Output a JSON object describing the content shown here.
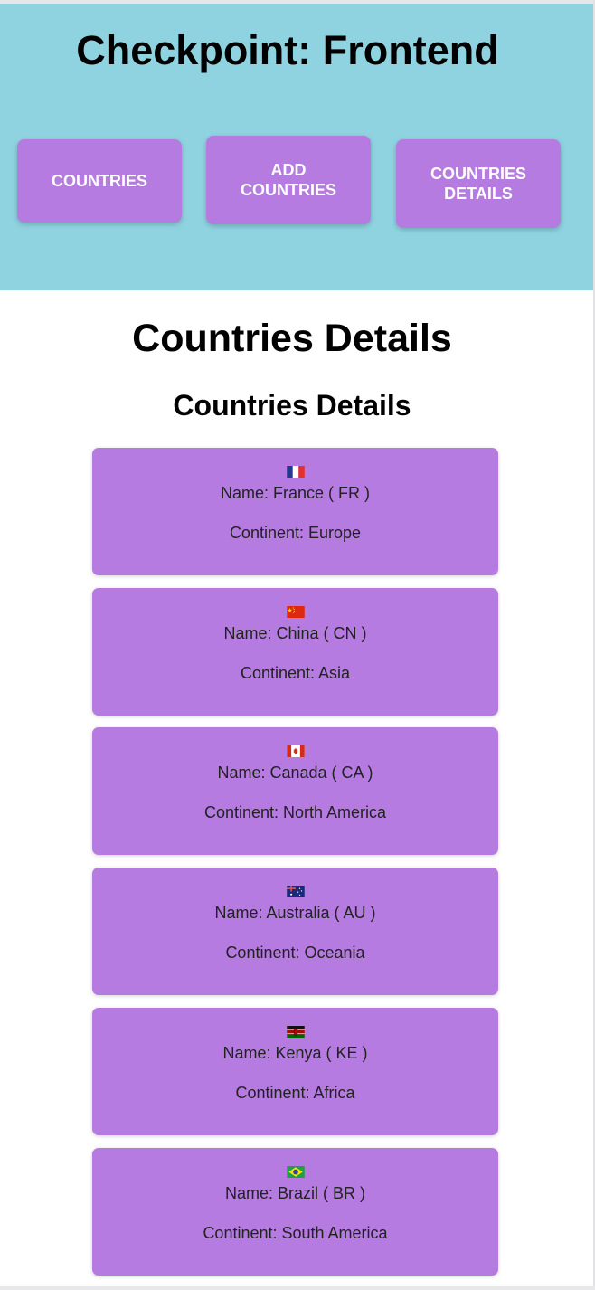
{
  "header": {
    "title": "Checkpoint: Frontend",
    "nav": [
      {
        "label": "Countries"
      },
      {
        "label": "Add Countries"
      },
      {
        "label": "Countries Details"
      }
    ]
  },
  "main": {
    "page_heading": "Countries Details",
    "section_heading": "Countries Details",
    "countries": [
      {
        "name_line": "Name: France ( FR )",
        "continent_line": "Continent: Europe",
        "flag_icon": "flag-fr"
      },
      {
        "name_line": "Name: China ( CN )",
        "continent_line": "Continent: Asia",
        "flag_icon": "flag-cn"
      },
      {
        "name_line": "Name: Canada ( CA )",
        "continent_line": "Continent: North America",
        "flag_icon": "flag-ca"
      },
      {
        "name_line": "Name: Australia ( AU )",
        "continent_line": "Continent: Oceania",
        "flag_icon": "flag-au"
      },
      {
        "name_line": "Name: Kenya ( KE )",
        "continent_line": "Continent: Africa",
        "flag_icon": "flag-ke"
      },
      {
        "name_line": "Name: Brazil ( BR )",
        "continent_line": "Continent: South America",
        "flag_icon": "flag-br"
      }
    ]
  },
  "colors": {
    "header_bg": "#8fd3e1",
    "accent": "#b57be0"
  }
}
